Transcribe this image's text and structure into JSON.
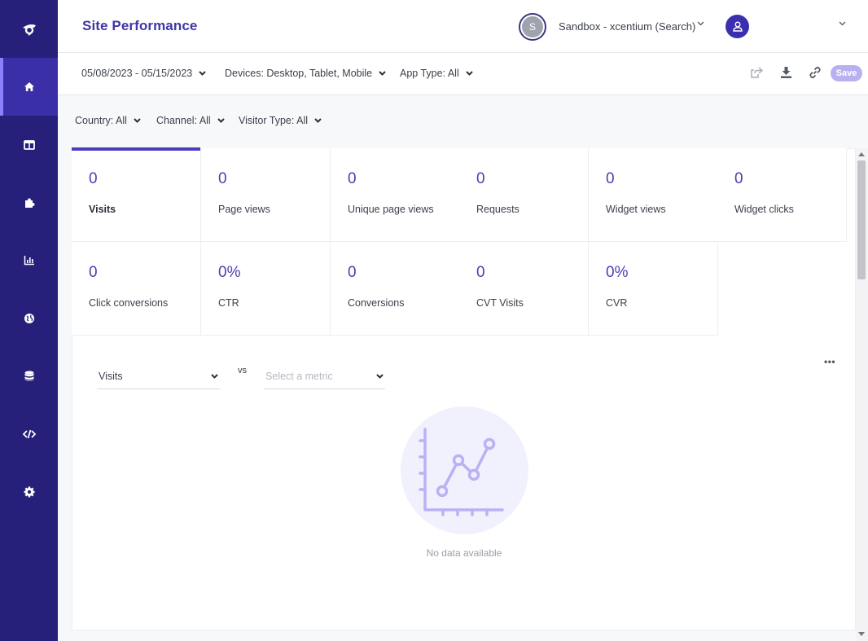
{
  "sidebar": {
    "logo_icon": "brand-logo-icon",
    "items": [
      {
        "icon": "home-icon",
        "active": true
      },
      {
        "icon": "layout-icon",
        "active": false
      },
      {
        "icon": "puzzle-icon",
        "active": false
      },
      {
        "icon": "bar-chart-icon",
        "active": false
      },
      {
        "icon": "globe-icon",
        "active": false
      },
      {
        "icon": "database-icon",
        "active": false
      },
      {
        "icon": "code-icon",
        "active": false
      },
      {
        "icon": "gear-icon",
        "active": false
      }
    ]
  },
  "header": {
    "title": "Site Performance",
    "workspace_initial": "S",
    "workspace_name": "Sandbox - xcentium (Search)"
  },
  "filters": {
    "date_range": "05/08/2023 - 05/15/2023",
    "devices": "Devices: Desktop, Tablet, Mobile",
    "app_type": "App Type: All",
    "country": "Country: All",
    "channel": "Channel: All",
    "visitor_type": "Visitor Type: All"
  },
  "toolbar": {
    "save_label": "Save"
  },
  "metrics": [
    {
      "value": "0",
      "label": "Visits",
      "active": true
    },
    {
      "value": "0",
      "label": "Page views"
    },
    {
      "value": "0",
      "label": "Unique page views"
    },
    {
      "value": "0",
      "label": "Requests"
    },
    {
      "value": "0",
      "label": "Widget views"
    },
    {
      "value": "0",
      "label": "Widget clicks"
    },
    {
      "value": "0",
      "label": "Click conversions"
    },
    {
      "value": "0%",
      "label": "CTR"
    },
    {
      "value": "0",
      "label": "Conversions"
    },
    {
      "value": "0",
      "label": "CVT Visits"
    },
    {
      "value": "0%",
      "label": "CVR"
    }
  ],
  "chart_controls": {
    "primary_metric": "Visits",
    "vs_label": "vs",
    "secondary_placeholder": "Select a metric",
    "more_label": "•••"
  },
  "empty_state": {
    "text": "No data available"
  },
  "colors": {
    "sidebar_bg": "#26207a",
    "accent": "#4a40b3",
    "save_button": "#b8b0f0"
  }
}
